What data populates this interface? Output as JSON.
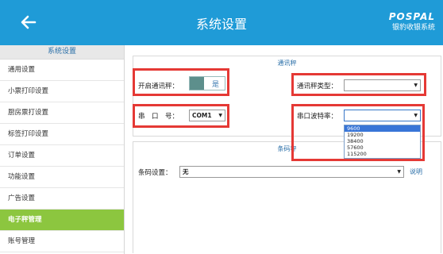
{
  "header": {
    "title": "系统设置",
    "logo_brand": "POSPAL",
    "logo_tagline": "银豹收银系统",
    "accent_color": "#1f9bd7"
  },
  "sidebar": {
    "heading": "系统设置",
    "items": [
      {
        "label": "通用设置"
      },
      {
        "label": "小票打印设置"
      },
      {
        "label": "厨房票打设置"
      },
      {
        "label": "标签打印设置"
      },
      {
        "label": "订单设置"
      },
      {
        "label": "功能设置"
      },
      {
        "label": "广告设置"
      },
      {
        "label": "电子秤管理",
        "active": true
      },
      {
        "label": "账号管理"
      }
    ],
    "active_color": "#8cc63f"
  },
  "scale_section": {
    "title": "通讯秤",
    "enable_label": "开启通讯秤：",
    "enable_toggle_text": "是",
    "scale_type_label": "通讯秤类型：",
    "scale_type_value": "",
    "port_label": "串　口　号：",
    "port_value": "COM1",
    "baud_label": "串口波特率：",
    "baud_value": "",
    "baud_options": [
      "9600",
      "19200",
      "38400",
      "57600",
      "115200"
    ],
    "baud_highlighted": "9600"
  },
  "barcode_section": {
    "title": "条码秤",
    "setting_label": "条码设置：",
    "setting_value": "无",
    "help_link": "说明"
  },
  "annotation_color": "#e53935"
}
